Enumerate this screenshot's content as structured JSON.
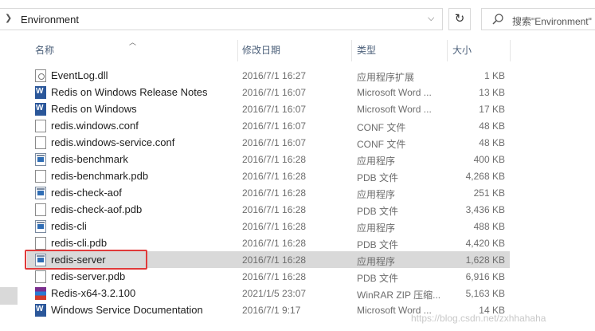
{
  "address_bar": {
    "path": "Environment",
    "search_placeholder": "搜索\"Environment\""
  },
  "columns": {
    "name": "名称",
    "date": "修改日期",
    "type": "类型",
    "size": "大小"
  },
  "files": [
    {
      "name": "EventLog.dll",
      "date": "2016/7/1 16:27",
      "type": "应用程序扩展",
      "size": "1 KB",
      "icon": "dll-icon"
    },
    {
      "name": "Redis on Windows Release Notes",
      "date": "2016/7/1 16:07",
      "type": "Microsoft Word ...",
      "size": "13 KB",
      "icon": "word-icon"
    },
    {
      "name": "Redis on Windows",
      "date": "2016/7/1 16:07",
      "type": "Microsoft Word ...",
      "size": "17 KB",
      "icon": "word-icon"
    },
    {
      "name": "redis.windows.conf",
      "date": "2016/7/1 16:07",
      "type": "CONF 文件",
      "size": "48 KB",
      "icon": "file-icon"
    },
    {
      "name": "redis.windows-service.conf",
      "date": "2016/7/1 16:07",
      "type": "CONF 文件",
      "size": "48 KB",
      "icon": "file-icon"
    },
    {
      "name": "redis-benchmark",
      "date": "2016/7/1 16:28",
      "type": "应用程序",
      "size": "400 KB",
      "icon": "exe-icon"
    },
    {
      "name": "redis-benchmark.pdb",
      "date": "2016/7/1 16:28",
      "type": "PDB 文件",
      "size": "4,268 KB",
      "icon": "file-icon"
    },
    {
      "name": "redis-check-aof",
      "date": "2016/7/1 16:28",
      "type": "应用程序",
      "size": "251 KB",
      "icon": "exe-icon"
    },
    {
      "name": "redis-check-aof.pdb",
      "date": "2016/7/1 16:28",
      "type": "PDB 文件",
      "size": "3,436 KB",
      "icon": "file-icon"
    },
    {
      "name": "redis-cli",
      "date": "2016/7/1 16:28",
      "type": "应用程序",
      "size": "488 KB",
      "icon": "exe-icon"
    },
    {
      "name": "redis-cli.pdb",
      "date": "2016/7/1 16:28",
      "type": "PDB 文件",
      "size": "4,420 KB",
      "icon": "file-icon"
    },
    {
      "name": "redis-server",
      "date": "2016/7/1 16:28",
      "type": "应用程序",
      "size": "1,628 KB",
      "icon": "exe-icon",
      "selected": true
    },
    {
      "name": "redis-server.pdb",
      "date": "2016/7/1 16:28",
      "type": "PDB 文件",
      "size": "6,916 KB",
      "icon": "file-icon"
    },
    {
      "name": "Redis-x64-3.2.100",
      "date": "2021/1/5 23:07",
      "type": "WinRAR ZIP 压缩...",
      "size": "5,163 KB",
      "icon": "winrar-icon"
    },
    {
      "name": "Windows Service Documentation",
      "date": "2016/7/1 9:17",
      "type": "Microsoft Word ...",
      "size": "14 KB",
      "icon": "word-icon"
    }
  ],
  "watermark": "https://blog.csdn.net/zxhhahaha",
  "colors": {
    "selection": "#d9d9d9",
    "highlight_border": "#e03a3a",
    "header_text": "#4c607a"
  }
}
